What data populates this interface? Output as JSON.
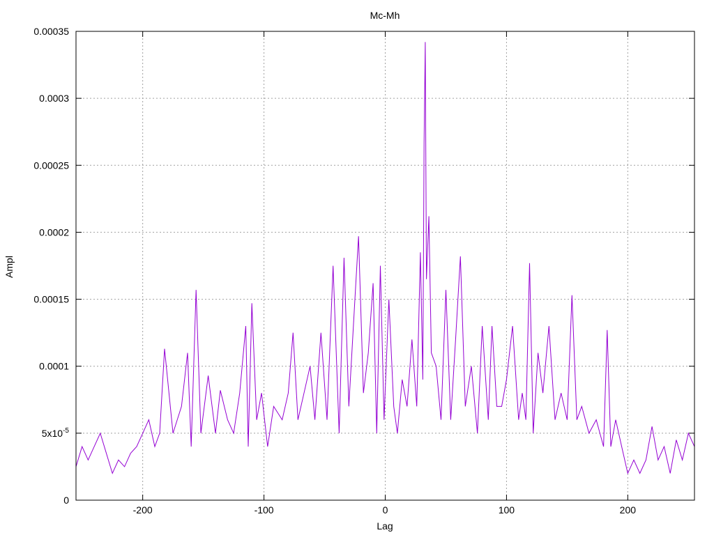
{
  "chart_data": {
    "type": "line",
    "title": "Mc-Mh",
    "xlabel": "Lag",
    "ylabel": "Ampl",
    "xlim": [
      -255,
      255
    ],
    "ylim": [
      0,
      0.00035
    ],
    "grid": true,
    "x_ticks": [
      {
        "value": -200,
        "label": "-200"
      },
      {
        "value": -100,
        "label": "-100"
      },
      {
        "value": 0,
        "label": "0"
      },
      {
        "value": 100,
        "label": "100"
      },
      {
        "value": 200,
        "label": "200"
      }
    ],
    "y_ticks": [
      {
        "value": 0,
        "label": "0"
      },
      {
        "value": 5e-05,
        "label": "5x10",
        "sup": "-5"
      },
      {
        "value": 0.0001,
        "label": "0.0001"
      },
      {
        "value": 0.00015,
        "label": "0.00015"
      },
      {
        "value": 0.0002,
        "label": "0.0002"
      },
      {
        "value": 0.00025,
        "label": "0.00025"
      },
      {
        "value": 0.0003,
        "label": "0.0003"
      },
      {
        "value": 0.00035,
        "label": "0.00035"
      }
    ],
    "series": [
      {
        "color": "#9400d3",
        "x": [
          -255,
          -250,
          -245,
          -240,
          -235,
          -230,
          -225,
          -220,
          -215,
          -210,
          -205,
          -200,
          -195,
          -190,
          -186,
          -182,
          -175,
          -168,
          -163,
          -160,
          -156,
          -152,
          -146,
          -140,
          -136,
          -130,
          -125,
          -120,
          -115,
          -113,
          -110,
          -106,
          -102,
          -97,
          -92,
          -85,
          -80,
          -76,
          -72,
          -67,
          -62,
          -58,
          -53,
          -48,
          -43,
          -38,
          -34,
          -30,
          -25,
          -22,
          -18,
          -14,
          -10,
          -7,
          -4,
          -1,
          3,
          7,
          10,
          14,
          18,
          22,
          26,
          29,
          31,
          32,
          33,
          34,
          36,
          38,
          42,
          46,
          50,
          54,
          58,
          62,
          66,
          71,
          76,
          80,
          85,
          88,
          92,
          96,
          100,
          105,
          110,
          113,
          116,
          119,
          122,
          126,
          130,
          135,
          140,
          145,
          150,
          154,
          158,
          162,
          168,
          174,
          180,
          183,
          186,
          190,
          195,
          200,
          205,
          210,
          215,
          220,
          225,
          230,
          235,
          240,
          245,
          250,
          255
        ],
        "y": [
          2.5e-05,
          4e-05,
          3e-05,
          4e-05,
          5e-05,
          3.5e-05,
          2e-05,
          3e-05,
          2.5e-05,
          3.5e-05,
          4e-05,
          5e-05,
          6e-05,
          4e-05,
          5e-05,
          0.000113,
          5e-05,
          7e-05,
          0.00011,
          4e-05,
          0.000157,
          5e-05,
          9.3e-05,
          5e-05,
          8.2e-05,
          6e-05,
          5e-05,
          8e-05,
          0.00013,
          4e-05,
          0.000147,
          6e-05,
          8e-05,
          4e-05,
          7e-05,
          6e-05,
          8e-05,
          0.000125,
          6e-05,
          8e-05,
          0.0001,
          6e-05,
          0.000125,
          6e-05,
          0.000175,
          5e-05,
          0.000181,
          7e-05,
          0.00015,
          0.000197,
          8e-05,
          0.00011,
          0.000162,
          5e-05,
          0.000175,
          6e-05,
          0.00015,
          7e-05,
          5e-05,
          9e-05,
          7e-05,
          0.00012,
          7e-05,
          0.000185,
          9e-05,
          0.000267,
          0.000342,
          0.000165,
          0.000212,
          0.00011,
          0.0001,
          6e-05,
          0.000157,
          6e-05,
          0.00012,
          0.000182,
          7e-05,
          0.0001,
          5e-05,
          0.00013,
          6e-05,
          0.00013,
          7e-05,
          7e-05,
          9e-05,
          0.00013,
          6e-05,
          8e-05,
          6e-05,
          0.000177,
          5e-05,
          0.00011,
          8e-05,
          0.00013,
          6e-05,
          8e-05,
          6e-05,
          0.000153,
          6e-05,
          7e-05,
          5e-05,
          6e-05,
          4e-05,
          0.000127,
          4e-05,
          6e-05,
          4e-05,
          2e-05,
          3e-05,
          2e-05,
          3e-05,
          5.5e-05,
          3e-05,
          4e-05,
          2e-05,
          4.5e-05,
          3e-05,
          5e-05,
          4e-05
        ]
      }
    ]
  }
}
